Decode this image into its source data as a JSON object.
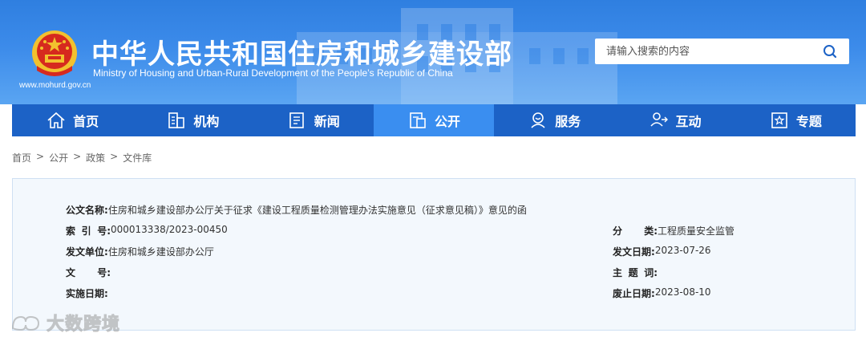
{
  "header": {
    "title_cn": "中华人民共和国住房和城乡建设部",
    "title_en": "Ministry of Housing and Urban-Rural Development of the People’s Republic of China",
    "site_url": "www.mohurd.gov.cn"
  },
  "search": {
    "placeholder": "请输入搜索的内容"
  },
  "nav": {
    "items": [
      {
        "label": "首页",
        "icon": "home-icon"
      },
      {
        "label": "机构",
        "icon": "building-icon"
      },
      {
        "label": "新闻",
        "icon": "news-icon"
      },
      {
        "label": "公开",
        "icon": "document-icon",
        "active": true
      },
      {
        "label": "服务",
        "icon": "service-icon"
      },
      {
        "label": "互动",
        "icon": "interaction-icon"
      },
      {
        "label": "专题",
        "icon": "topic-icon"
      }
    ]
  },
  "breadcrumb": {
    "home": "首页",
    "open": "公开",
    "policy": "政策",
    "library": "文件库",
    "separator": ">"
  },
  "document": {
    "title_label": "公文名称:",
    "title_value": "住房和城乡建设部办公厅关于征求《建设工程质量检测管理办法实施意见（征求意见稿）》意见的函",
    "index_label": [
      "索",
      "引",
      "号:"
    ],
    "index_value": "000013338/2023-00450",
    "category_label": [
      "分",
      "类:"
    ],
    "category_value": "工程质量安全监管",
    "issuer_label": "发文单位:",
    "issuer_value": "住房和城乡建设部办公厅",
    "date_label": "发文日期:",
    "date_value": "2023-07-26",
    "docno_label": [
      "文",
      "号:"
    ],
    "docno_value": "",
    "subject_label": [
      "主",
      "题",
      "词:"
    ],
    "subject_value": "",
    "effective_label": "实施日期:",
    "effective_value": "",
    "deadline_label": "废止日期:",
    "deadline_value": "2023-08-10"
  },
  "watermark": {
    "text": "大数跨境"
  },
  "colors": {
    "header_blue": "#3c8bea",
    "nav_blue": "#1c62c6",
    "nav_active": "#3a8ef0",
    "emblem_red": "#d62a1e",
    "emblem_gold": "#f2c12e"
  }
}
